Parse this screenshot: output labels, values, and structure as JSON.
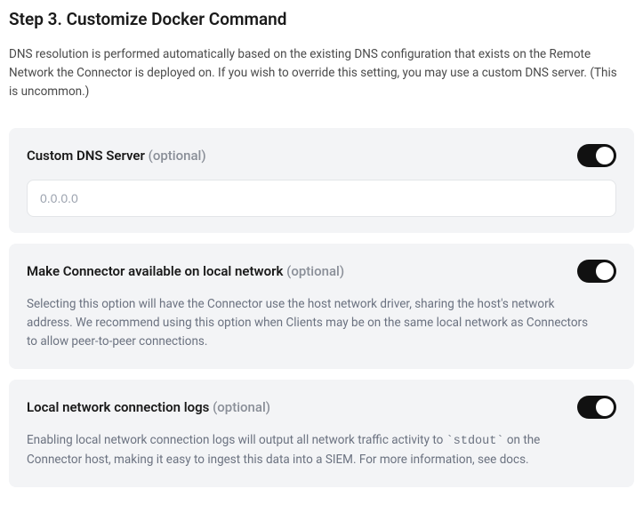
{
  "heading": "Step 3. Customize Docker Command",
  "intro": "DNS resolution is performed automatically based on the existing DNS configuration that exists on the Remote Network the Connector is deployed on. If you wish to override this setting, you may use a custom DNS server. (This is uncommon.)",
  "optional_label": "(optional)",
  "cards": {
    "dns": {
      "title": "Custom DNS Server ",
      "placeholder": "0.0.0.0",
      "value": "",
      "toggle_on": true
    },
    "local_network": {
      "title": "Make Connector available on local network ",
      "desc": "Selecting this option will have the Connector use the host network driver, sharing the host's network address. We recommend using this option when Clients may be on the same local network as Connectors to allow peer-to-peer connections.",
      "toggle_on": true
    },
    "logs": {
      "title": "Local network connection logs ",
      "desc_pre": "Enabling local network connection logs will output all network traffic activity to ",
      "desc_code": "`stdout`",
      "desc_post": " on the Connector host, making it easy to ingest this data into a SIEM. For more information, see docs.",
      "toggle_on": true
    }
  }
}
